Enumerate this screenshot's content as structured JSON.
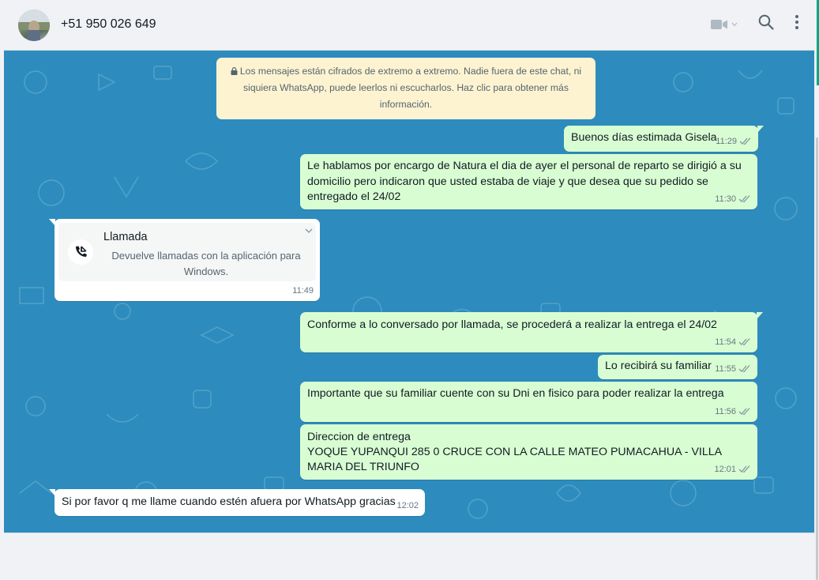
{
  "header": {
    "contact_name": "+51 950 026 649",
    "icons": [
      "avatar",
      "video-call-icon",
      "chevron-down-icon",
      "search-icon",
      "menu-dots-icon"
    ]
  },
  "encryption_notice": "Los mensajes están cifrados de extremo a extremo. Nadie fuera de este chat, ni siquiera WhatsApp, puede leerlos ni escucharlos. Haz clic para obtener más información.",
  "messages": [
    {
      "direction": "out",
      "text": "Buenos días estimada Gisela",
      "time": "11:29"
    },
    {
      "direction": "out",
      "text": "Le hablamos por encargo de Natura el dia de ayer el personal de reparto se dirigió a su domicilio pero indicaron que usted estaba de viaje y que desea que su pedido se entregado el 24/02",
      "time": "11:30"
    },
    {
      "direction": "in",
      "type": "call",
      "title": "Llamada",
      "description": "Devuelve llamadas con la aplicación para Windows.",
      "time": "11:49"
    },
    {
      "direction": "out",
      "text": "Conforme a lo conversado por llamada, se procederá a realizar la entrega el 24/02",
      "time": "11:54"
    },
    {
      "direction": "out",
      "text": "Lo recibirá su familiar",
      "time": "11:55"
    },
    {
      "direction": "out",
      "text": "Importante que su familiar cuente con su Dni en fisico para poder realizar la entrega",
      "time": "11:56"
    },
    {
      "direction": "out",
      "text": "Direccion de entrega\nYOQUE YUPANQUI 285 0 CRUCE CON LA CALLE MATEO PUMACAHUA - VILLA MARIA DEL TRIUNFO",
      "time": "12:01"
    },
    {
      "direction": "in",
      "text": "Si por favor q me llame cuando estén afuera por WhatsApp gracias",
      "time": "12:02"
    }
  ],
  "colors": {
    "chat_background": "#2d8cbd",
    "outgoing_bubble": "#d9fdd3",
    "incoming_bubble": "#ffffff",
    "encryption_notice": "#fdf3d1",
    "header": "#f0f2f5"
  }
}
